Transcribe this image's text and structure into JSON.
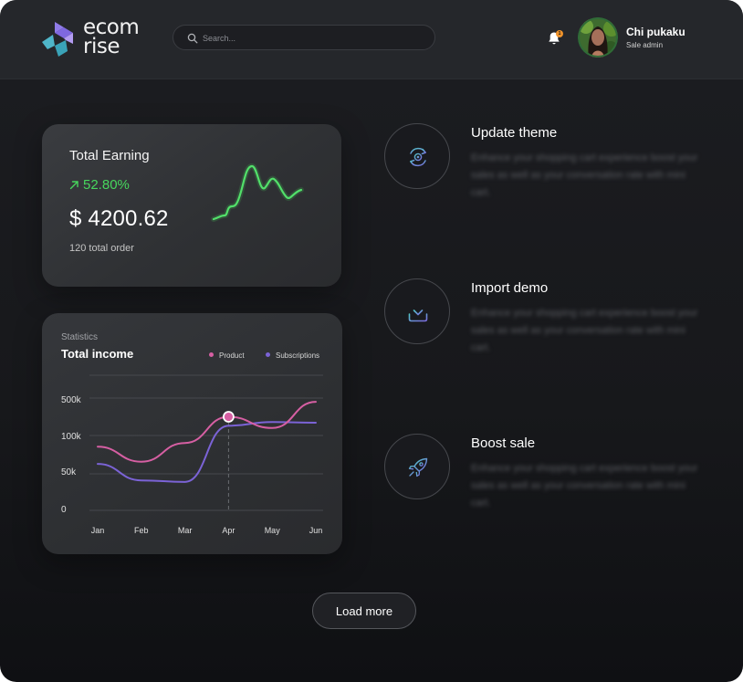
{
  "brand": {
    "line1": "ecom",
    "line2": "rise"
  },
  "search": {
    "placeholder": "Search..."
  },
  "notifications": {
    "count": "1"
  },
  "user": {
    "name": "Chi pukaku",
    "role": "Sale admin"
  },
  "earning": {
    "title": "Total Earning",
    "percent": "52.80%",
    "amount": "$ 4200.62",
    "orders": "120 total order",
    "accent": "#47d65d"
  },
  "statistics": {
    "subtitle": "Statistics",
    "title": "Total income",
    "legend": [
      {
        "name": "Product",
        "color": "#d65fa3"
      },
      {
        "name": "Subscriptions",
        "color": "#7b63d6"
      }
    ]
  },
  "chart_data": {
    "type": "line",
    "title": "Total income",
    "x": [
      "Jan",
      "Feb",
      "Mar",
      "Apr",
      "May",
      "Jun"
    ],
    "y_ticks": [
      "500k",
      "100k",
      "50k",
      "0"
    ],
    "series": [
      {
        "name": "Product",
        "color": "#d65fa3",
        "values": [
          85,
          65,
          90,
          125,
          110,
          145
        ]
      },
      {
        "name": "Subscriptions",
        "color": "#7b63d6",
        "values": [
          62,
          40,
          38,
          113,
          118,
          117
        ]
      }
    ],
    "highlight": {
      "x": "Apr",
      "series": "Product"
    },
    "grid": true
  },
  "features": [
    {
      "icon": "gear-sync-icon",
      "title": "Update theme",
      "desc": "Enhance your shopping cart experience boost your sales as well as your conversation rate with mini cart."
    },
    {
      "icon": "download-icon",
      "title": "Import demo",
      "desc": "Enhance your shopping cart experience boost your sales as well as your conversation rate with mini cart."
    },
    {
      "icon": "rocket-icon",
      "title": "Boost sale",
      "desc": "Enhance your shopping cart experience boost your sales as well as your conversation rate with mini cart."
    }
  ],
  "load_more": {
    "label": "Load more"
  }
}
